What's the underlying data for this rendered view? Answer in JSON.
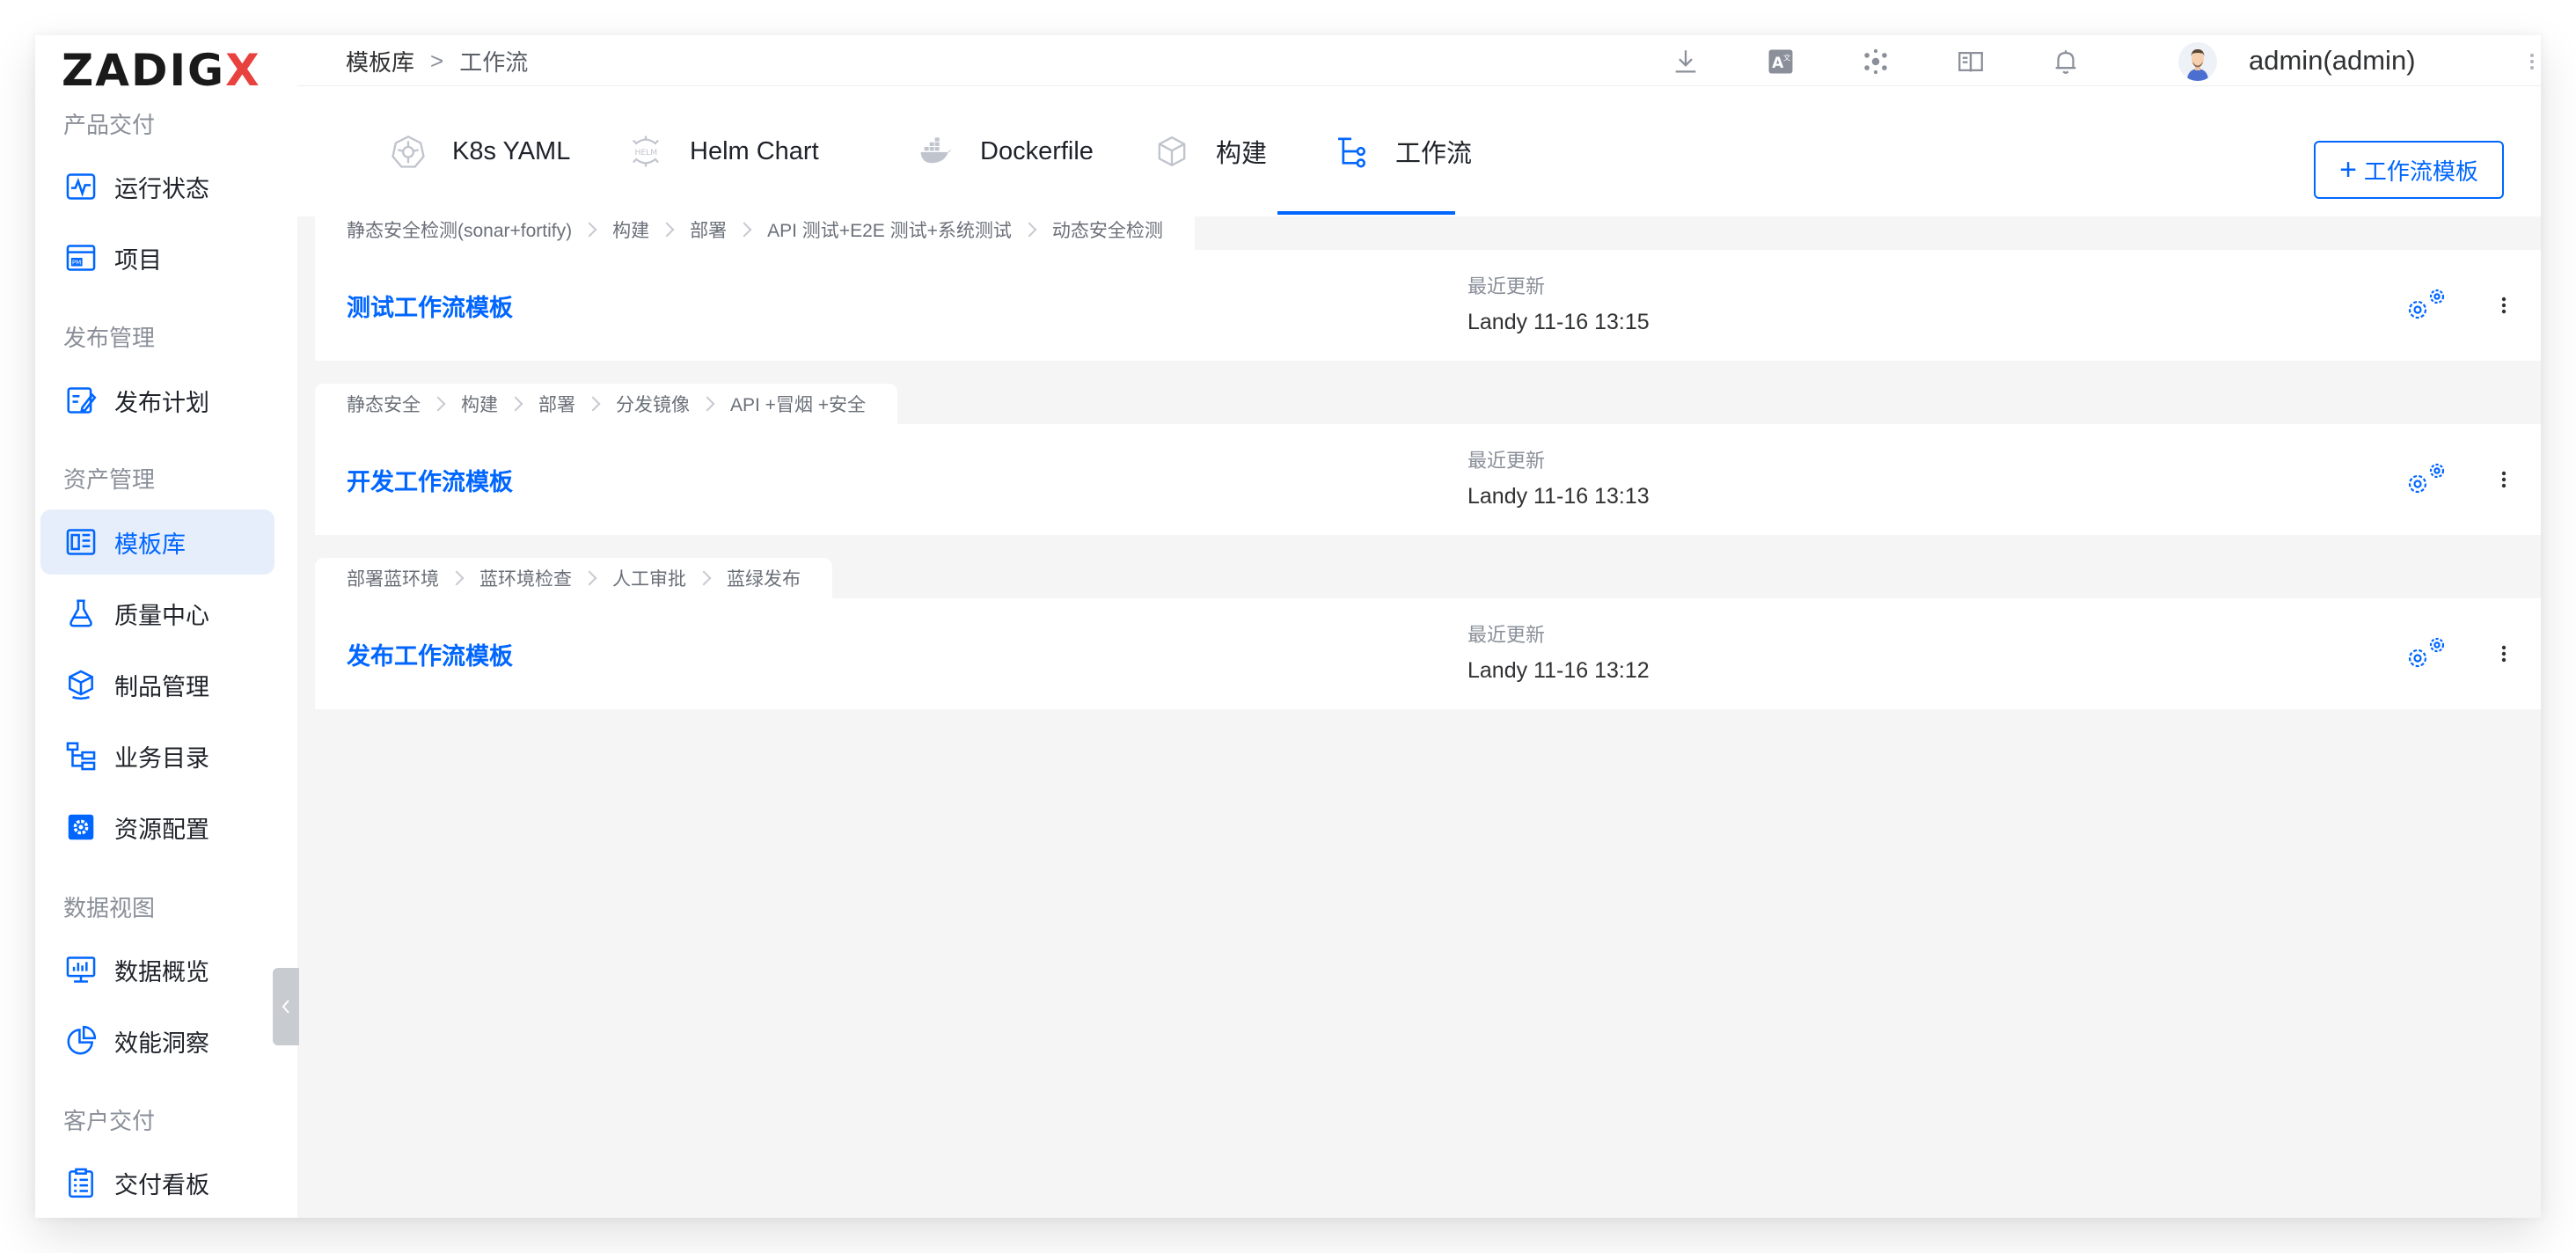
{
  "brand": {
    "logo_main": "ZADIG",
    "logo_accent": "X",
    "accent_color": "#0066ff",
    "logo_accent_color": "#e8423f"
  },
  "sidebar": {
    "groups": [
      {
        "title": "产品交付",
        "items": [
          {
            "label": "运行状态",
            "icon": "pulse-icon"
          },
          {
            "label": "项目",
            "icon": "project-icon"
          }
        ]
      },
      {
        "title": "发布管理",
        "items": [
          {
            "label": "发布计划",
            "icon": "plan-icon"
          }
        ]
      },
      {
        "title": "资产管理",
        "items": [
          {
            "label": "模板库",
            "icon": "template-icon",
            "active": true
          },
          {
            "label": "质量中心",
            "icon": "flask-icon"
          },
          {
            "label": "制品管理",
            "icon": "box-icon"
          },
          {
            "label": "业务目录",
            "icon": "tree-icon"
          },
          {
            "label": "资源配置",
            "icon": "gear-box-icon"
          }
        ]
      },
      {
        "title": "数据视图",
        "items": [
          {
            "label": "数据概览",
            "icon": "monitor-chart-icon"
          },
          {
            "label": "效能洞察",
            "icon": "pie-icon"
          }
        ]
      },
      {
        "title": "客户交付",
        "items": [
          {
            "label": "交付看板",
            "icon": "clipboard-icon"
          }
        ]
      }
    ]
  },
  "header": {
    "breadcrumb_root": "模板库",
    "breadcrumb_sep": ">",
    "breadcrumb_current": "工作流",
    "user_name": "admin(admin)",
    "icons": [
      "download-icon",
      "translate-icon",
      "plugin-icon",
      "book-icon",
      "bell-icon"
    ]
  },
  "tabs": [
    {
      "label": "K8s YAML",
      "icon": "k8s-icon"
    },
    {
      "label": "Helm Chart",
      "icon": "helm-icon"
    },
    {
      "label": "Dockerfile",
      "icon": "docker-icon"
    },
    {
      "label": "构建",
      "icon": "cube-icon"
    },
    {
      "label": "工作流",
      "icon": "workflow-icon",
      "active": true
    }
  ],
  "add_button": {
    "plus": "+",
    "label": "工作流模板"
  },
  "workflows": [
    {
      "steps": [
        "静态安全检测(sonar+fortify)",
        "构建",
        "部署",
        "API 测试+E2E 测试+系统测试",
        "动态安全检测"
      ],
      "name": "测试工作流模板",
      "updated_label": "最近更新",
      "updated_value": "Landy 11-16 13:15"
    },
    {
      "steps": [
        "静态安全",
        "构建",
        "部署",
        "分发镜像",
        "API +冒烟 +安全"
      ],
      "name": "开发工作流模板",
      "updated_label": "最近更新",
      "updated_value": "Landy 11-16 13:13"
    },
    {
      "steps": [
        "部署蓝环境",
        "蓝环境检查",
        "人工审批",
        "蓝绿发布"
      ],
      "name": "发布工作流模板",
      "updated_label": "最近更新",
      "updated_value": "Landy 11-16 13:12"
    }
  ]
}
